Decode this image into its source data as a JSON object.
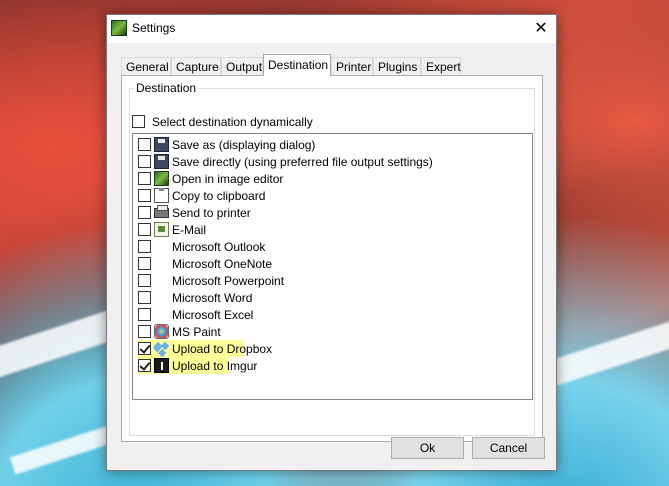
{
  "window": {
    "title": "Settings",
    "close_glyph": "✕",
    "icon": "greenshot-icon"
  },
  "tabs": [
    {
      "label": "General",
      "active": false
    },
    {
      "label": "Capture",
      "active": false
    },
    {
      "label": "Output",
      "active": false
    },
    {
      "label": "Destination",
      "active": true
    },
    {
      "label": "Printer",
      "active": false
    },
    {
      "label": "Plugins",
      "active": false
    },
    {
      "label": "Expert",
      "active": false
    }
  ],
  "destination": {
    "group_label": "Destination",
    "dynamic": {
      "label": "Select destination dynamically",
      "checked": false
    },
    "items": [
      {
        "label": "Save as (displaying dialog)",
        "checked": false,
        "icon": "floppy-icon"
      },
      {
        "label": "Save directly (using preferred file output settings)",
        "checked": false,
        "icon": "floppy-icon"
      },
      {
        "label": "Open in image editor",
        "checked": false,
        "icon": "image-editor-icon"
      },
      {
        "label": "Copy to clipboard",
        "checked": false,
        "icon": "clipboard-icon"
      },
      {
        "label": "Send to printer",
        "checked": false,
        "icon": "printer-icon"
      },
      {
        "label": "E-Mail",
        "checked": false,
        "icon": "email-icon"
      },
      {
        "label": "Microsoft Outlook",
        "checked": false,
        "icon": ""
      },
      {
        "label": "Microsoft OneNote",
        "checked": false,
        "icon": ""
      },
      {
        "label": "Microsoft Powerpoint",
        "checked": false,
        "icon": ""
      },
      {
        "label": "Microsoft Word",
        "checked": false,
        "icon": ""
      },
      {
        "label": "Microsoft Excel",
        "checked": false,
        "icon": ""
      },
      {
        "label": "MS Paint",
        "checked": false,
        "icon": "paint-icon"
      },
      {
        "label": "Upload to Dropbox",
        "checked": true,
        "icon": "dropbox-icon"
      },
      {
        "label": "Upload to Imgur",
        "checked": true,
        "icon": "imgur-icon"
      }
    ]
  },
  "buttons": {
    "ok_label": "Ok",
    "cancel_label": "Cancel"
  },
  "colors": {
    "highlight": "#ffff99",
    "window_bg": "#f0f0f0"
  }
}
